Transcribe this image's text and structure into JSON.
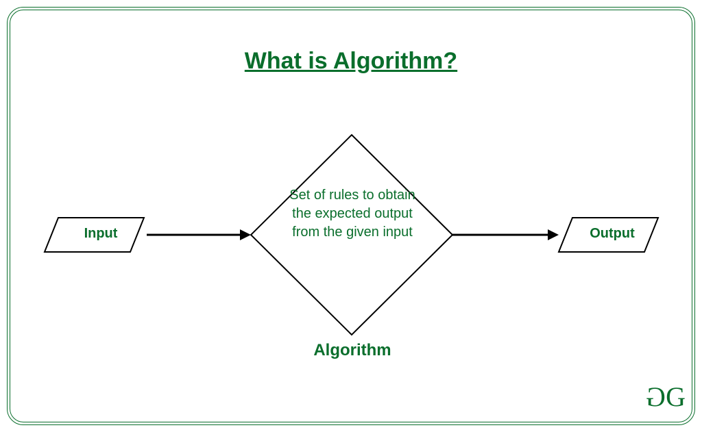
{
  "title": "What is Algorithm?",
  "nodes": {
    "input": {
      "label": "Input"
    },
    "process": {
      "description": "Set of rules to obtain the expected output from the given input",
      "caption": "Algorithm"
    },
    "output": {
      "label": "Output"
    }
  },
  "logo": {
    "left_glyph": "G",
    "right_glyph": "G"
  },
  "colors": {
    "brand": "#0a6e2c",
    "stroke": "#000000"
  }
}
